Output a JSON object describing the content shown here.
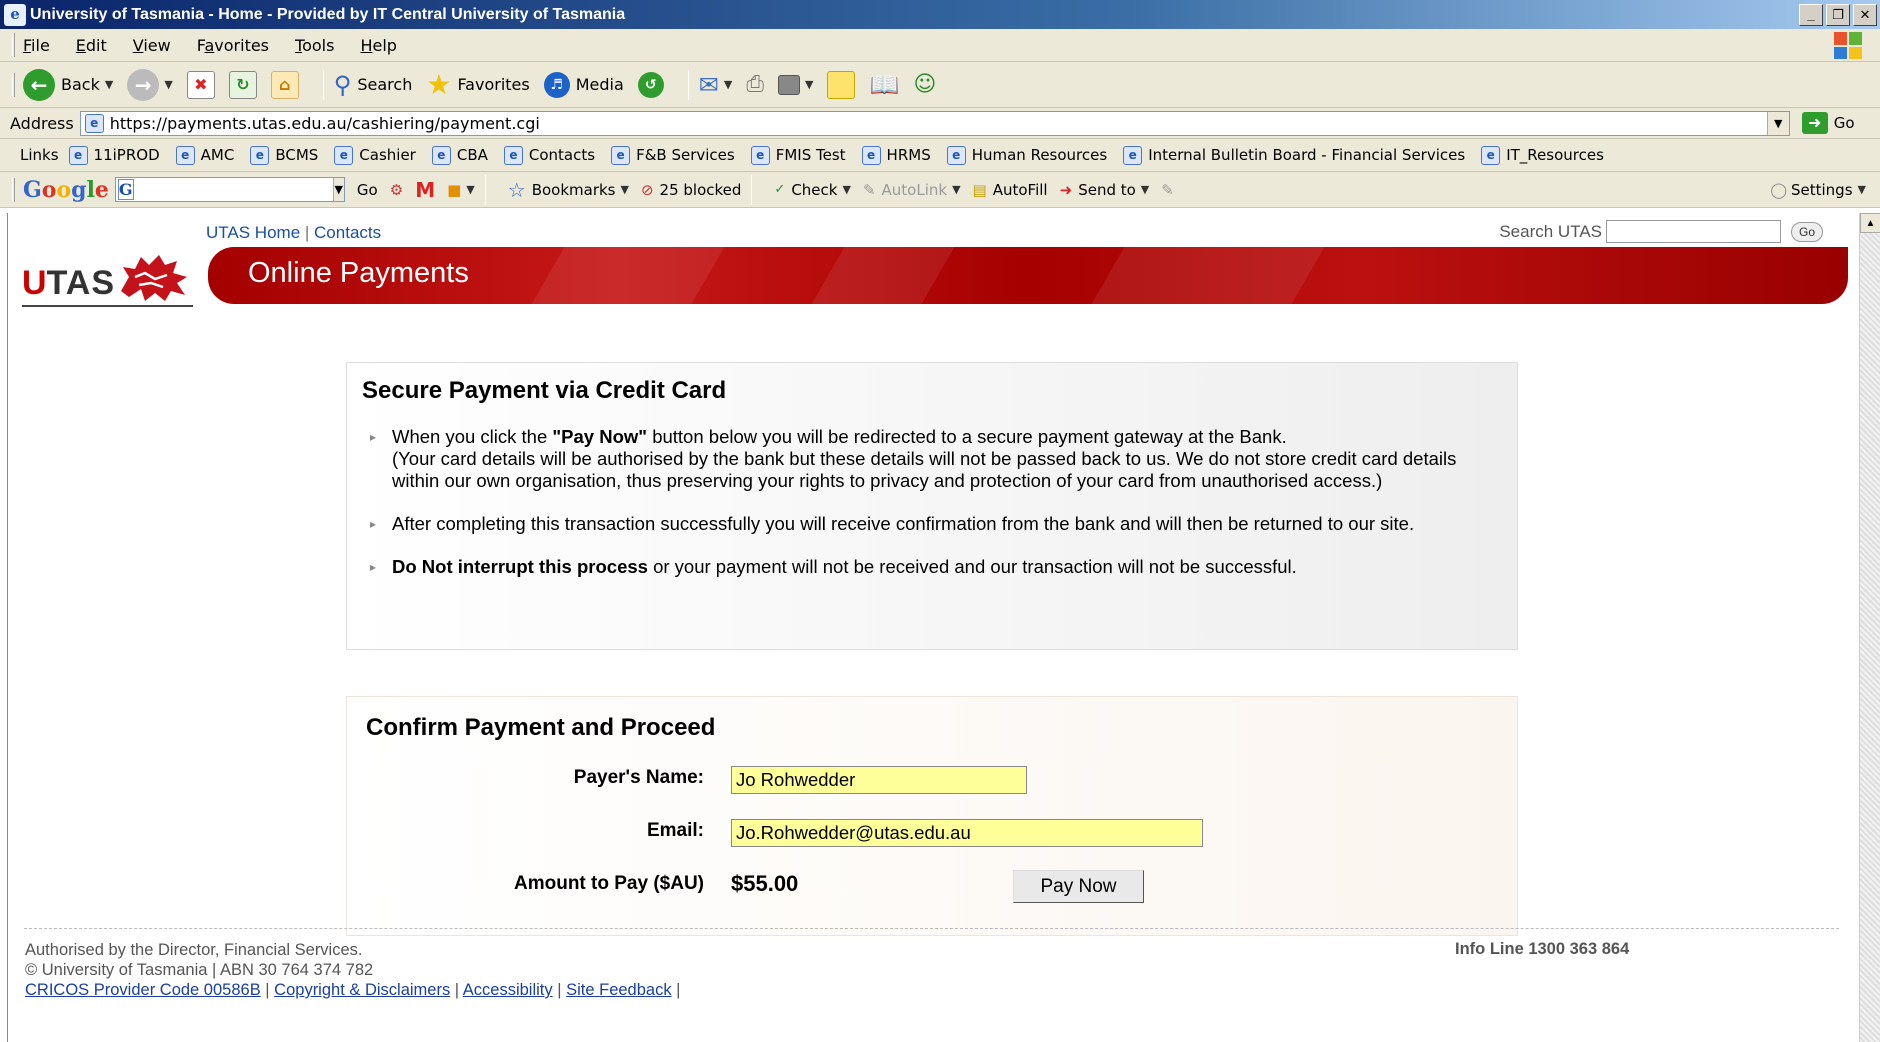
{
  "window": {
    "title": "University of Tasmania - Home - Provided by IT Central University of Tasmania",
    "min": "_",
    "max": "❐",
    "close": "✕"
  },
  "menu": [
    {
      "accel": "F",
      "rest": "ile"
    },
    {
      "accel": "E",
      "rest": "dit"
    },
    {
      "accel": "V",
      "rest": "iew"
    },
    {
      "accel": "a",
      "pre": "F",
      "rest": "vorites"
    },
    {
      "accel": "T",
      "rest": "ools"
    },
    {
      "accel": "H",
      "rest": "elp"
    }
  ],
  "toolbar": {
    "back": "Back",
    "search": "Search",
    "favorites": "Favorites",
    "media": "Media"
  },
  "address": {
    "label": "Address",
    "url": "https://payments.utas.edu.au/cashiering/payment.cgi",
    "go": "Go"
  },
  "links": {
    "label": "Links",
    "items": [
      "11iPROD",
      "AMC",
      "BCMS",
      "Cashier",
      "CBA",
      "Contacts",
      "F&B Services",
      "FMIS Test",
      "HRMS",
      "Human Resources",
      "Internal Bulletin Board - Financial Services",
      "IT_Resources"
    ]
  },
  "google": {
    "logo": "Google",
    "go": "Go",
    "bookmarks": "Bookmarks",
    "blocked": "25 blocked",
    "check": "Check",
    "autolink": "AutoLink",
    "autofill": "AutoFill",
    "sendto": "Send to",
    "settings": "Settings"
  },
  "site": {
    "home": "UTAS Home",
    "contacts": "Contacts",
    "search_label": "Search UTAS",
    "search_go": "Go",
    "logo_u": "U",
    "logo_tas": "TAS",
    "banner": "Online Payments"
  },
  "secure": {
    "heading": "Secure Payment via Credit Card",
    "b1_pre": "When you click the ",
    "b1_bold": "\"Pay Now\"",
    "b1_post": " button below you will be redirected to a secure payment gateway at the Bank.",
    "b1_line2": "(Your card details will be authorised by the bank but these details will not be passed back to us. We do not store credit card details within our own organisation, thus preserving your rights to privacy and protection of your card from unauthorised access.)",
    "b2": "After completing this transaction successfully you will receive confirmation from the bank and will then be returned to our site.",
    "b3_bold": "Do Not interrupt this process",
    "b3_post": " or your payment will not be received and our transaction will not be successful."
  },
  "confirm": {
    "heading": "Confirm Payment and Proceed",
    "name_label": "Payer's Name:",
    "name_value": "Jo Rohwedder",
    "email_label": "Email:",
    "email_value": "Jo.Rohwedder@utas.edu.au",
    "amount_label": "Amount to Pay ($AU)",
    "amount_value": "$55.00",
    "pay_button": "Pay Now"
  },
  "footer": {
    "line1": "Authorised by the Director, Financial Services.",
    "line2": "© University of Tasmania | ABN 30 764 374 782",
    "cricos": "CRICOS Provider Code 00586B",
    "copyright": "Copyright & Disclaimers",
    "accessibility": "Accessibility",
    "feedback": "Site Feedback",
    "sep": " | ",
    "trail": " |",
    "infoline": "Info Line 1300 363 864"
  }
}
